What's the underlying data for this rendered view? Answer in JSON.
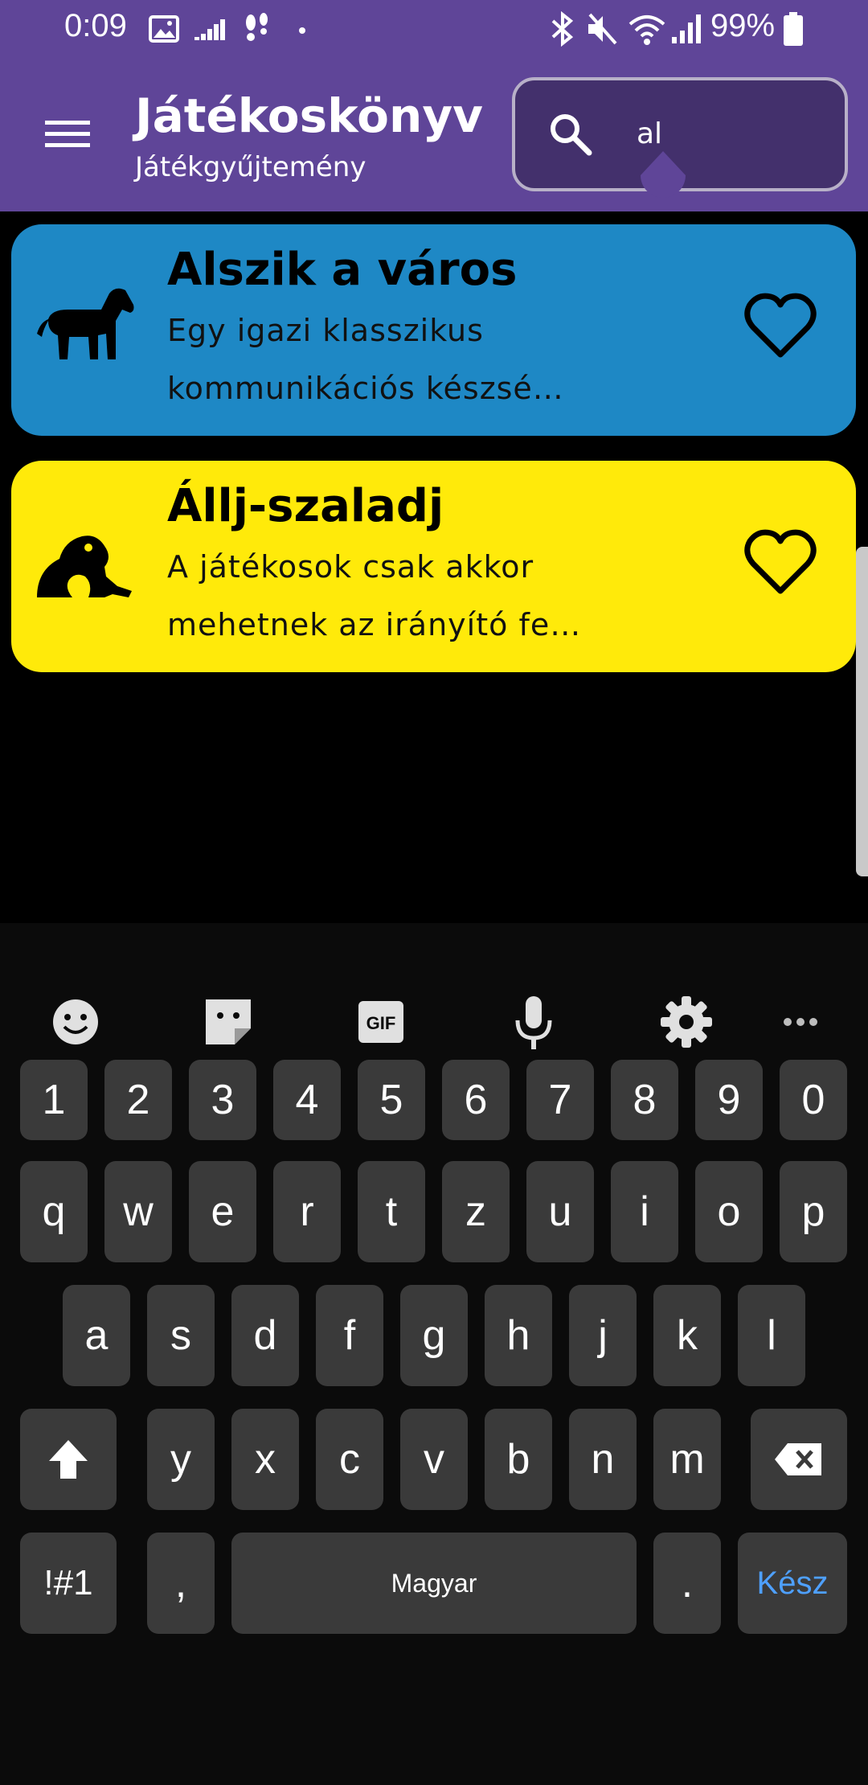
{
  "status_bar": {
    "time": "0:09",
    "battery": "99%"
  },
  "header": {
    "title": "Játékoskönyv",
    "subtitle": "Játékgyűjtemény"
  },
  "search": {
    "value": "al"
  },
  "games": [
    {
      "title": "Alszik a város",
      "description": "Egy igazi klasszikus kommunikációs készsé…",
      "icon": "horse-icon",
      "color": "#1e88c5"
    },
    {
      "title": "Állj-szaladj",
      "description": "A játékosok csak akkor mehetnek az irányító fe…",
      "icon": "frog-icon",
      "color": "#ffea0a"
    }
  ],
  "keyboard": {
    "toolbar": [
      "emoji-icon",
      "sticker-icon",
      "gif-icon",
      "microphone-icon",
      "settings-icon",
      "more-icon"
    ],
    "gif_label": "GIF",
    "row_numbers": [
      "1",
      "2",
      "3",
      "4",
      "5",
      "6",
      "7",
      "8",
      "9",
      "0"
    ],
    "row_1": [
      "q",
      "w",
      "e",
      "r",
      "t",
      "z",
      "u",
      "i",
      "o",
      "p"
    ],
    "row_2": [
      "a",
      "s",
      "d",
      "f",
      "g",
      "h",
      "j",
      "k",
      "l"
    ],
    "row_3": [
      "y",
      "x",
      "c",
      "v",
      "b",
      "n",
      "m"
    ],
    "symbols_label": "!#1",
    "comma": ",",
    "space_label": "Magyar",
    "period": ".",
    "done_label": "Kész"
  }
}
